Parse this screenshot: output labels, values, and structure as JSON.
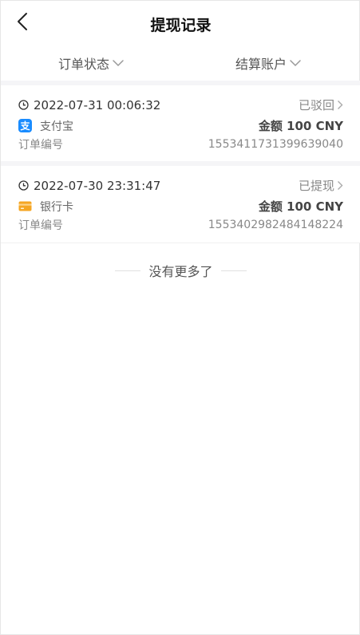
{
  "header": {
    "title": "提现记录"
  },
  "filters": {
    "status_label": "订单状态",
    "account_label": "结算账户"
  },
  "records": [
    {
      "time": "2022-07-31 00:06:32",
      "status": "已驳回",
      "method_icon": "alipay-icon",
      "method": "支付宝",
      "amount": "金额 100 CNY",
      "order_label": "订单编号",
      "order_no": "1553411731399639040"
    },
    {
      "time": "2022-07-30 23:31:47",
      "status": "已提现",
      "method_icon": "bank-card-icon",
      "method": "银行卡",
      "amount": "金额 100 CNY",
      "order_label": "订单编号",
      "order_no": "1553402982484148224"
    }
  ],
  "footer": {
    "no_more": "没有更多了"
  },
  "colors": {
    "alipay": "#1a8cff",
    "bank_card": "#f5a623",
    "divider": "#f5f5f7"
  }
}
